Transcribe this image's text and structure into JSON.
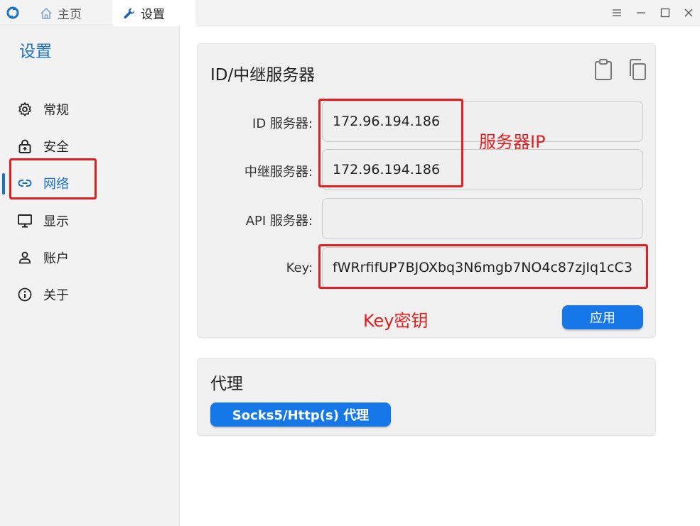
{
  "titlebar": {
    "tabs": [
      {
        "label": "主页",
        "icon": "home-icon"
      },
      {
        "label": "设置",
        "icon": "wrench-icon"
      }
    ],
    "controls": [
      "menu-icon",
      "minimize-icon",
      "maximize-icon",
      "close-icon"
    ]
  },
  "sidebar": {
    "title": "设置",
    "items": [
      {
        "label": "常规",
        "icon": "gear-icon"
      },
      {
        "label": "安全",
        "icon": "lock-icon"
      },
      {
        "label": "网络",
        "icon": "link-icon",
        "active": true
      },
      {
        "label": "显示",
        "icon": "monitor-icon"
      },
      {
        "label": "账户",
        "icon": "person-icon"
      },
      {
        "label": "关于",
        "icon": "info-icon"
      }
    ]
  },
  "server_card": {
    "title": "ID/中继服务器",
    "fields": [
      {
        "label": "ID 服务器:",
        "value": "172.96.194.186"
      },
      {
        "label": "中继服务器:",
        "value": "172.96.194.186"
      },
      {
        "label": "API 服务器:",
        "value": ""
      },
      {
        "label": "Key:",
        "value": "fWRrfifUP7BJOXbq3N6mgb7NO4c87zjIq1cC3"
      }
    ],
    "apply_label": "应用"
  },
  "proxy_card": {
    "title": "代理",
    "button_label": "Socks5/Http(s) 代理"
  },
  "annotations": {
    "server_ip": "服务器IP",
    "key": "Key密钥"
  },
  "colors": {
    "accent": "#1677e8",
    "annotation": "#e02020",
    "active_nav": "#1a73c8"
  }
}
